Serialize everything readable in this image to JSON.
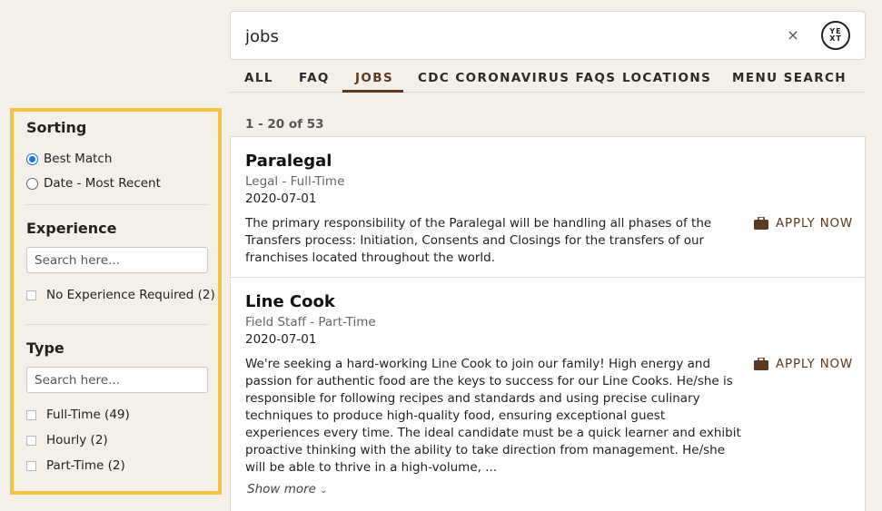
{
  "search": {
    "query": "jobs",
    "clear_label": "×",
    "logo_text": "YE XT"
  },
  "tabs": [
    {
      "label": "ALL"
    },
    {
      "label": "FAQ"
    },
    {
      "label": "JOBS",
      "active": true
    },
    {
      "label": "CDC CORONAVIRUS FAQS"
    },
    {
      "label": "LOCATIONS"
    },
    {
      "label": "MENU SEARCH"
    }
  ],
  "sidebar": {
    "sorting": {
      "title": "Sorting",
      "options": [
        {
          "label": "Best Match",
          "checked": true
        },
        {
          "label": "Date - Most Recent",
          "checked": false
        }
      ]
    },
    "experience": {
      "title": "Experience",
      "placeholder": "Search here...",
      "options": [
        {
          "label": "No Experience Required (2)"
        }
      ]
    },
    "type": {
      "title": "Type",
      "placeholder": "Search here...",
      "options": [
        {
          "label": "Full-Time (49)"
        },
        {
          "label": "Hourly (2)"
        },
        {
          "label": "Part-Time (2)"
        }
      ]
    },
    "highlight_color": "#f5c242"
  },
  "results": {
    "count": "1 - 20 of 53",
    "apply_label": "APPLY NOW",
    "show_more_label": "Show more",
    "items": [
      {
        "title": "Paralegal",
        "subtitle": "Legal - Full-Time",
        "date": "2020-07-01",
        "description": "The primary responsibility of the Paralegal will be handling all phases of the Transfers process: Initiation, Consents and Closings for the transfers of our franchises located throughout the world."
      },
      {
        "title": "Line Cook",
        "subtitle": "Field Staff - Part-Time",
        "date": "2020-07-01",
        "description": "We're seeking a hard-working Line Cook to join our family! High energy and passion for authentic food are the keys to success for our Line Cooks. He/she is responsible for following recipes and standards and using precise culinary techniques to produce high-quality food, ensuring exceptional guest experiences every time. The ideal candidate must be a quick learner and exhibit proactive thinking with the ability to take direction from management. He/she will be able to thrive in a high-volume, ..."
      }
    ]
  },
  "colors": {
    "accent": "#5b3a1f",
    "background": "#f4efe9",
    "radio_selected": "#1a73e8"
  }
}
